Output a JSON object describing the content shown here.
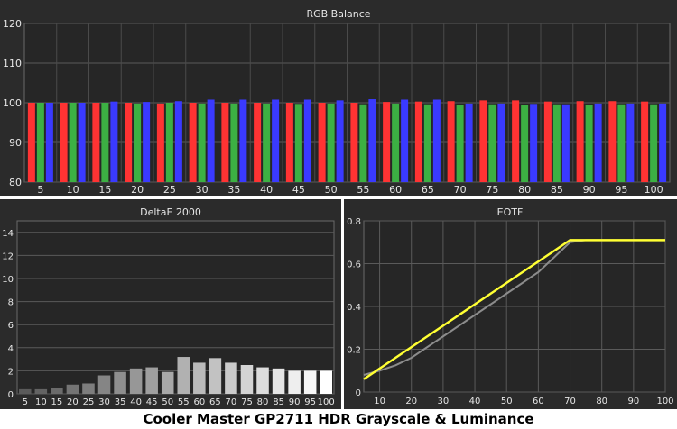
{
  "caption": "Cooler Master GP2711 HDR Grayscale & Luminance",
  "colors": {
    "panel_bg": "#2b2b2b",
    "plot_bg": "#262626",
    "grid": "#5a5a5a",
    "red": "#ff3333",
    "green": "#3cb043",
    "blue": "#3a3aff",
    "eotf_target": "#8c8c8c",
    "eotf_measured": "#ffff33"
  },
  "chart_data": [
    {
      "type": "bar",
      "title": "RGB Balance",
      "xlabel": "",
      "ylabel": "",
      "ylim": [
        80,
        120
      ],
      "yticks": [
        80,
        90,
        100,
        110,
        120
      ],
      "categories": [
        "5",
        "10",
        "15",
        "20",
        "25",
        "30",
        "35",
        "40",
        "45",
        "50",
        "55",
        "60",
        "65",
        "70",
        "75",
        "80",
        "85",
        "90",
        "95",
        "100"
      ],
      "series": [
        {
          "color": "red",
          "values": [
            100.0,
            100.0,
            100.0,
            100.0,
            99.8,
            100.0,
            100.0,
            100.0,
            100.0,
            100.0,
            100.0,
            100.2,
            100.3,
            100.4,
            100.6,
            100.6,
            100.3,
            100.4,
            100.4,
            100.3
          ]
        },
        {
          "color": "green",
          "values": [
            100.0,
            100.0,
            100.0,
            99.8,
            100.0,
            99.8,
            99.8,
            99.8,
            99.7,
            99.8,
            99.6,
            99.8,
            99.6,
            99.5,
            99.6,
            99.5,
            99.6,
            99.5,
            99.6,
            99.6
          ]
        },
        {
          "color": "blue",
          "values": [
            100.0,
            100.0,
            100.3,
            100.2,
            100.4,
            100.8,
            100.8,
            100.8,
            100.8,
            100.6,
            100.9,
            100.8,
            100.8,
            99.8,
            99.8,
            99.7,
            99.6,
            99.8,
            99.8,
            99.8
          ]
        }
      ],
      "grid": true
    },
    {
      "type": "bar",
      "title": "DeltaE 2000",
      "xlabel": "",
      "ylabel": "",
      "ylim": [
        0,
        15
      ],
      "yticks": [
        0,
        2,
        4,
        6,
        8,
        10,
        12,
        14
      ],
      "categories": [
        "5",
        "10",
        "15",
        "20",
        "25",
        "30",
        "35",
        "40",
        "45",
        "50",
        "55",
        "60",
        "65",
        "70",
        "75",
        "80",
        "85",
        "90",
        "95",
        "100"
      ],
      "values": [
        0.4,
        0.4,
        0.5,
        0.8,
        0.9,
        1.6,
        1.9,
        2.2,
        2.3,
        1.9,
        3.2,
        2.7,
        3.1,
        2.7,
        2.5,
        2.3,
        2.2,
        2.0,
        2.0,
        2.0
      ],
      "grid": true
    },
    {
      "type": "line",
      "title": "EOTF",
      "xlabel": "",
      "ylabel": "",
      "xlim": [
        5,
        100
      ],
      "ylim": [
        0,
        0.8
      ],
      "xticks": [
        10,
        20,
        30,
        40,
        50,
        60,
        70,
        80,
        90,
        100
      ],
      "yticks": [
        0,
        0.2,
        0.4,
        0.6,
        0.8
      ],
      "series": [
        {
          "color": "gray",
          "x": [
            5,
            10,
            15,
            20,
            25,
            30,
            35,
            40,
            45,
            50,
            55,
            60,
            65,
            70,
            75,
            80,
            85,
            90,
            95,
            100
          ],
          "y": [
            0.08,
            0.1,
            0.125,
            0.16,
            0.21,
            0.26,
            0.31,
            0.36,
            0.41,
            0.46,
            0.51,
            0.56,
            0.63,
            0.7,
            0.71,
            0.71,
            0.71,
            0.71,
            0.71,
            0.71
          ]
        },
        {
          "color": "yellow",
          "x": [
            5,
            10,
            15,
            20,
            25,
            30,
            35,
            40,
            45,
            50,
            55,
            60,
            65,
            70,
            75,
            80,
            85,
            90,
            95,
            100
          ],
          "y": [
            0.06,
            0.11,
            0.16,
            0.21,
            0.26,
            0.31,
            0.36,
            0.41,
            0.46,
            0.51,
            0.56,
            0.61,
            0.66,
            0.71,
            0.71,
            0.71,
            0.71,
            0.71,
            0.71,
            0.71
          ]
        }
      ],
      "grid": true
    }
  ]
}
